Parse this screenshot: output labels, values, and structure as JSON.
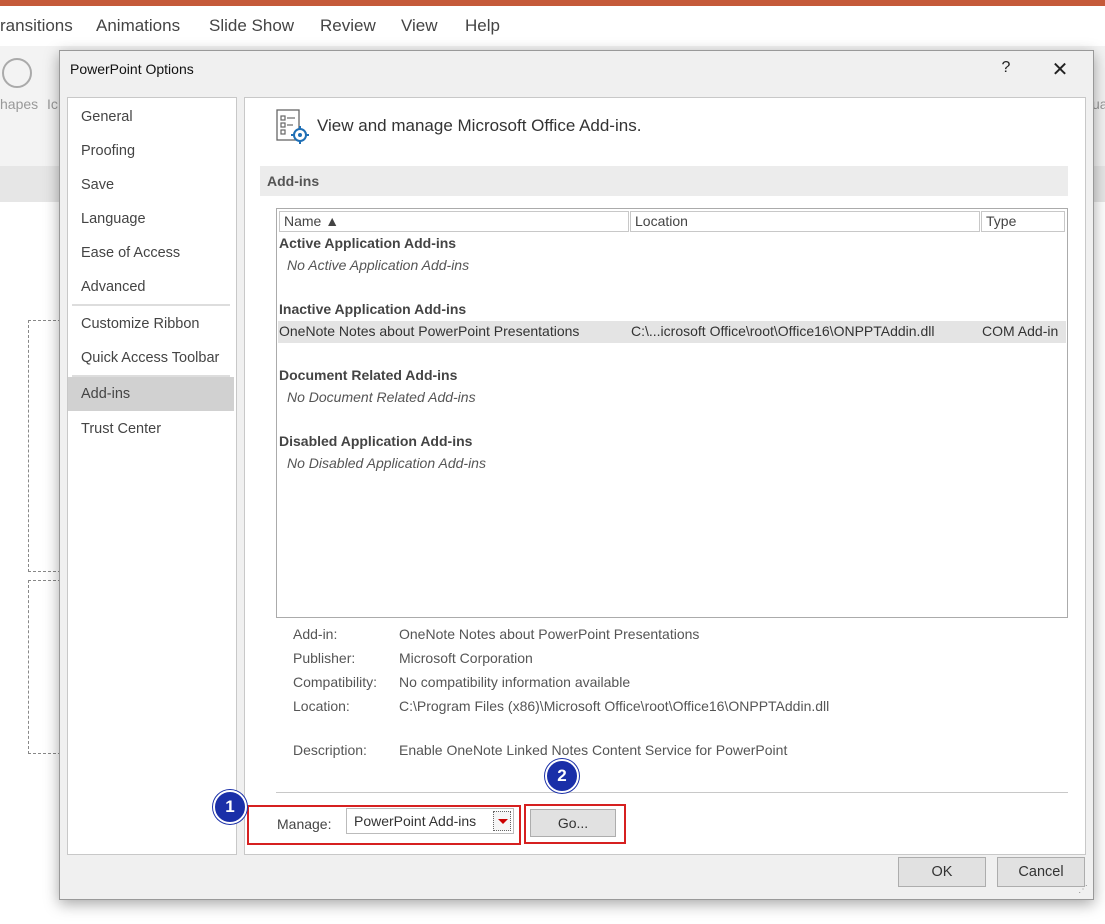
{
  "app_menu": {
    "items": [
      "ransitions",
      "Animations",
      "Slide Show",
      "Review",
      "View",
      "Help"
    ],
    "ribbon_partial_left": "hapes",
    "ribbon_partial_left2": "Ic",
    "ribbon_partial_right": "ua"
  },
  "dialog": {
    "title": "PowerPoint Options",
    "help_label": "?",
    "close_label": "✕",
    "nav": {
      "items": [
        "General",
        "Proofing",
        "Save",
        "Language",
        "Ease of Access",
        "Advanced",
        "Customize Ribbon",
        "Quick Access Toolbar",
        "Add-ins",
        "Trust Center"
      ],
      "selected": "Add-ins"
    },
    "header_text": "View and manage Microsoft Office Add-ins.",
    "section_label": "Add-ins",
    "grid": {
      "columns": [
        "Name ▲",
        "Location",
        "Type"
      ],
      "groups": [
        {
          "title": "Active Application Add-ins",
          "empty_text": "No Active Application Add-ins"
        },
        {
          "title": "Inactive Application Add-ins",
          "row": {
            "name": "OneNote Notes about PowerPoint Presentations",
            "location": "C:\\...icrosoft Office\\root\\Office16\\ONPPTAddin.dll",
            "type": "COM Add-in"
          }
        },
        {
          "title": "Document Related Add-ins",
          "empty_text": "No Document Related Add-ins"
        },
        {
          "title": "Disabled Application Add-ins",
          "empty_text": "No Disabled Application Add-ins"
        }
      ]
    },
    "details": {
      "addin_label": "Add-in:",
      "addin_value": "OneNote Notes about PowerPoint Presentations",
      "publisher_label": "Publisher:",
      "publisher_value": "Microsoft Corporation",
      "compat_label": "Compatibility:",
      "compat_value": "No compatibility information available",
      "location_label": "Location:",
      "location_value": "C:\\Program Files (x86)\\Microsoft Office\\root\\Office16\\ONPPTAddin.dll",
      "description_label": "Description:",
      "description_value": "Enable OneNote Linked Notes Content Service for PowerPoint"
    },
    "manage": {
      "label": "Manage:",
      "selected": "PowerPoint Add-ins",
      "go_label": "Go..."
    },
    "badges": [
      "1",
      "2"
    ],
    "ok_label": "OK",
    "cancel_label": "Cancel"
  },
  "colors": {
    "highlight_red": "#d62020",
    "badge_blue": "#1a2fa8",
    "title_bar_accent": "#c55a3a"
  }
}
